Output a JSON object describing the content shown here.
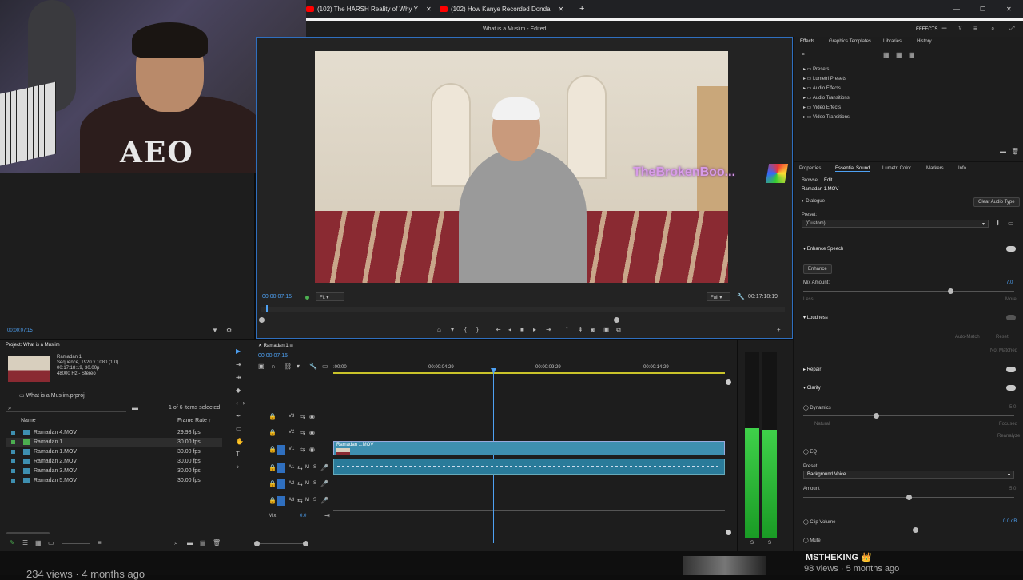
{
  "browser": {
    "tabs": [
      {
        "label": "(102) The HARSH Reality of Why Y"
      },
      {
        "label": "(102) How Kanye Recorded Donda"
      }
    ],
    "new_tab": "+",
    "minimize": "—",
    "maximize": "☐",
    "close": "✕"
  },
  "premiere": {
    "window_title": "What is a Muslim - Edited",
    "workspace": "EFFECTS",
    "program_monitor": {
      "timecode": "00:00:07:15",
      "fit": "Fit",
      "quality": "Full",
      "duration": "00:17:18:19",
      "watermark": "TheBrokenBoo..."
    },
    "source_timecode": "00:00:07:15",
    "effects_panel": {
      "tabs": [
        "Effects",
        "Graphics Templates",
        "Libraries",
        "History"
      ],
      "folders": [
        "Presets",
        "Lumetri Presets",
        "Audio Effects",
        "Audio Transitions",
        "Video Effects",
        "Video Transitions"
      ]
    },
    "essential_sound": {
      "tabs": [
        "Properties",
        "Essential Sound",
        "Lumetri Color",
        "Markers",
        "Info"
      ],
      "subtabs": [
        "Browse",
        "Edit"
      ],
      "clip_name": "Ramadan 1.MOV",
      "type": "Dialogue",
      "clear_button": "Clear Audio Type",
      "preset_label": "Preset:",
      "preset_value": "(Custom)",
      "enhance_speech": "Enhance Speech",
      "enhance_button": "Enhance",
      "mix_amount": "Mix Amount:",
      "mix_value": "7.0",
      "less": "Less",
      "more": "More",
      "loudness": "Loudness",
      "auto_match": "Auto-Match",
      "reset": "Reset",
      "not_matched": "Not Matched",
      "repair": "Repair",
      "clarity": "Clarity",
      "dynamics": "Dynamics",
      "dynamics_value": "5.0",
      "natural": "Natural",
      "focused": "Focused",
      "eq": "EQ",
      "eq_preset_label": "Preset",
      "eq_preset": "Background Voice",
      "amount": "Amount",
      "amount_value": "5.0",
      "clip_volume": "Clip Volume",
      "clip_volume_value": "0.0 dB",
      "mute": "Mute"
    },
    "project": {
      "title": "Project: What is a Muslim",
      "seq_name": "Ramadan 1",
      "seq_info1": "Sequence, 1920 x 1080 (1.0)",
      "seq_info2": "00:17:18:19, 30.00p",
      "seq_info3": "48000 Hz - Stereo",
      "file": "What is a Muslim.prproj",
      "selected": "1 of 6 items selected",
      "col_name": "Name",
      "col_rate": "Frame Rate ↑",
      "items": [
        {
          "name": "Ramadan 4.MOV",
          "rate": "29.98 fps",
          "color": "#3e8fb0"
        },
        {
          "name": "Ramadan 1",
          "rate": "30.00 fps",
          "color": "#4caf50"
        },
        {
          "name": "Ramadan 1.MOV",
          "rate": "30.00 fps",
          "color": "#3e8fb0"
        },
        {
          "name": "Ramadan 2.MOV",
          "rate": "30.00 fps",
          "color": "#3e8fb0"
        },
        {
          "name": "Ramadan 3.MOV",
          "rate": "30.00 fps",
          "color": "#3e8fb0"
        },
        {
          "name": "Ramadan 5.MOV",
          "rate": "30.00 fps",
          "color": "#3e8fb0"
        }
      ]
    },
    "timeline": {
      "tab": "Ramadan 1",
      "timecode": "00:00:07:15",
      "ruler": [
        ":00:00",
        "00:00:04:29",
        "00:00:09:29",
        "00:00:14:29"
      ],
      "tracks": [
        "V3",
        "V2",
        "V1",
        "A1",
        "A2",
        "A3"
      ],
      "mix_label": "Mix",
      "mix_value": "0.0",
      "clip_label": "Ramadan 1.MOV"
    },
    "meter_labels": [
      "S",
      "S"
    ]
  },
  "youtube_bottom": {
    "views_left": "234 views · 4 months ago",
    "channel": "MSTHEKING 👑",
    "views_right": "98 views · 5 months ago"
  }
}
